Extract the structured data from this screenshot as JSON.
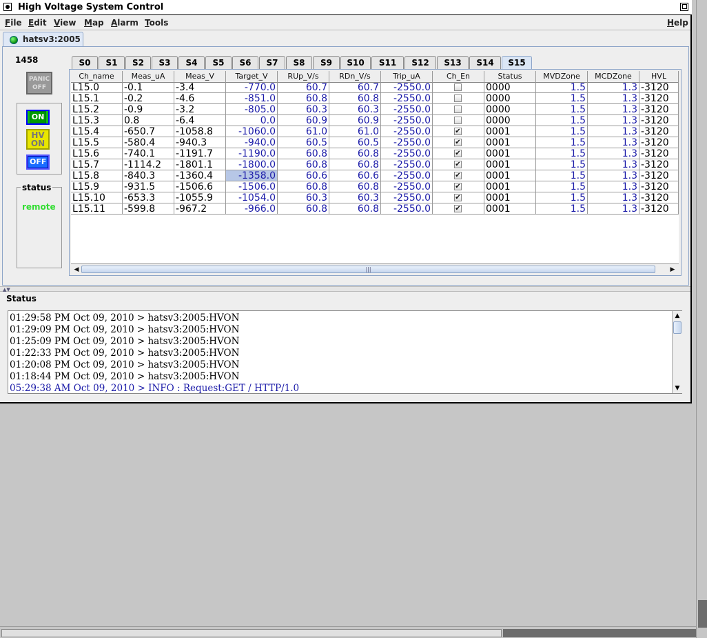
{
  "window": {
    "title": "High Voltage System Control"
  },
  "menu": {
    "file": "File",
    "edit": "Edit",
    "view": "View",
    "map": "Map",
    "alarm": "Alarm",
    "tools": "Tools",
    "help": "Help"
  },
  "host_tab": {
    "label": "hatsv3:2005"
  },
  "control": {
    "number": "1458",
    "panic_label": "PANIC OFF",
    "on_label": "ON",
    "hv_on_label": "HV ON",
    "off_label": "OFF",
    "status_title": "status",
    "status_value": "remote"
  },
  "slot_tabs": [
    "S0",
    "S1",
    "S2",
    "S3",
    "S4",
    "S5",
    "S6",
    "S7",
    "S8",
    "S9",
    "S10",
    "S11",
    "S12",
    "S13",
    "S14",
    "S15"
  ],
  "active_slot": "S15",
  "table": {
    "columns": [
      "Ch_name",
      "Meas_uA",
      "Meas_V",
      "Target_V",
      "RUp_V/s",
      "RDn_V/s",
      "Trip_uA",
      "Ch_En",
      "Status",
      "MVDZone",
      "MCDZone",
      "HVL"
    ],
    "rows": [
      {
        "ch": "L15.0",
        "ma": "-0.1",
        "mv": "-3.4",
        "tv": "-770.0",
        "ru": "60.7",
        "rd": "60.7",
        "tr": "-2550.0",
        "en": false,
        "st": "0000",
        "mvd": "1.5",
        "mcd": "1.3",
        "hvl": "-3120"
      },
      {
        "ch": "L15.1",
        "ma": "-0.2",
        "mv": "-4.6",
        "tv": "-851.0",
        "ru": "60.8",
        "rd": "60.8",
        "tr": "-2550.0",
        "en": false,
        "st": "0000",
        "mvd": "1.5",
        "mcd": "1.3",
        "hvl": "-3120"
      },
      {
        "ch": "L15.2",
        "ma": "-0.9",
        "mv": "-3.2",
        "tv": "-805.0",
        "ru": "60.3",
        "rd": "60.3",
        "tr": "-2550.0",
        "en": false,
        "st": "0000",
        "mvd": "1.5",
        "mcd": "1.3",
        "hvl": "-3120"
      },
      {
        "ch": "L15.3",
        "ma": "0.8",
        "mv": "-6.4",
        "tv": "0.0",
        "ru": "60.9",
        "rd": "60.9",
        "tr": "-2550.0",
        "en": false,
        "st": "0000",
        "mvd": "1.5",
        "mcd": "1.3",
        "hvl": "-3120"
      },
      {
        "ch": "L15.4",
        "ma": "-650.7",
        "mv": "-1058.8",
        "tv": "-1060.0",
        "ru": "61.0",
        "rd": "61.0",
        "tr": "-2550.0",
        "en": true,
        "st": "0001",
        "mvd": "1.5",
        "mcd": "1.3",
        "hvl": "-3120"
      },
      {
        "ch": "L15.5",
        "ma": "-580.4",
        "mv": "-940.3",
        "tv": "-940.0",
        "ru": "60.5",
        "rd": "60.5",
        "tr": "-2550.0",
        "en": true,
        "st": "0001",
        "mvd": "1.5",
        "mcd": "1.3",
        "hvl": "-3120"
      },
      {
        "ch": "L15.6",
        "ma": "-740.1",
        "mv": "-1191.7",
        "tv": "-1190.0",
        "ru": "60.8",
        "rd": "60.8",
        "tr": "-2550.0",
        "en": true,
        "st": "0001",
        "mvd": "1.5",
        "mcd": "1.3",
        "hvl": "-3120"
      },
      {
        "ch": "L15.7",
        "ma": "-1114.2",
        "mv": "-1801.1",
        "tv": "-1800.0",
        "ru": "60.8",
        "rd": "60.8",
        "tr": "-2550.0",
        "en": true,
        "st": "0001",
        "mvd": "1.5",
        "mcd": "1.3",
        "hvl": "-3120"
      },
      {
        "ch": "L15.8",
        "ma": "-840.3",
        "mv": "-1360.4",
        "tv": "-1358.0",
        "ru": "60.6",
        "rd": "60.6",
        "tr": "-2550.0",
        "en": true,
        "st": "0001",
        "mvd": "1.5",
        "mcd": "1.3",
        "hvl": "-3120",
        "selected": true
      },
      {
        "ch": "L15.9",
        "ma": "-931.5",
        "mv": "-1506.6",
        "tv": "-1506.0",
        "ru": "60.8",
        "rd": "60.8",
        "tr": "-2550.0",
        "en": true,
        "st": "0001",
        "mvd": "1.5",
        "mcd": "1.3",
        "hvl": "-3120"
      },
      {
        "ch": "L15.10",
        "ma": "-653.3",
        "mv": "-1055.9",
        "tv": "-1054.0",
        "ru": "60.3",
        "rd": "60.3",
        "tr": "-2550.0",
        "en": true,
        "st": "0001",
        "mvd": "1.5",
        "mcd": "1.3",
        "hvl": "-3120"
      },
      {
        "ch": "L15.11",
        "ma": "-599.8",
        "mv": "-967.2",
        "tv": "-966.0",
        "ru": "60.8",
        "rd": "60.8",
        "tr": "-2550.0",
        "en": true,
        "st": "0001",
        "mvd": "1.5",
        "mcd": "1.3",
        "hvl": "-3120"
      }
    ]
  },
  "status_panel": {
    "title": "Status",
    "log": [
      {
        "text": "01:29:58 PM Oct 09, 2010 > hatsv3:2005:HVON",
        "color": "#000000"
      },
      {
        "text": "01:29:09 PM Oct 09, 2010 > hatsv3:2005:HVON",
        "color": "#000000"
      },
      {
        "text": "01:25:09 PM Oct 09, 2010 > hatsv3:2005:HVON",
        "color": "#000000"
      },
      {
        "text": "01:22:33 PM Oct 09, 2010 > hatsv3:2005:HVON",
        "color": "#000000"
      },
      {
        "text": "01:20:08 PM Oct 09, 2010 > hatsv3:2005:HVON",
        "color": "#000000"
      },
      {
        "text": "01:18:44 PM Oct 09, 2010 > hatsv3:2005:HVON",
        "color": "#000000"
      },
      {
        "text": "05:29:38 AM Oct 09, 2010 > INFO : Request:GET / HTTP/1.0",
        "color": "#1a1aa8"
      }
    ]
  },
  "colors": {
    "accent": "#8da5c8",
    "value_blue": "#1a1aa8",
    "remote_green": "#33dd33",
    "hv_yellow": "#e8e600"
  }
}
